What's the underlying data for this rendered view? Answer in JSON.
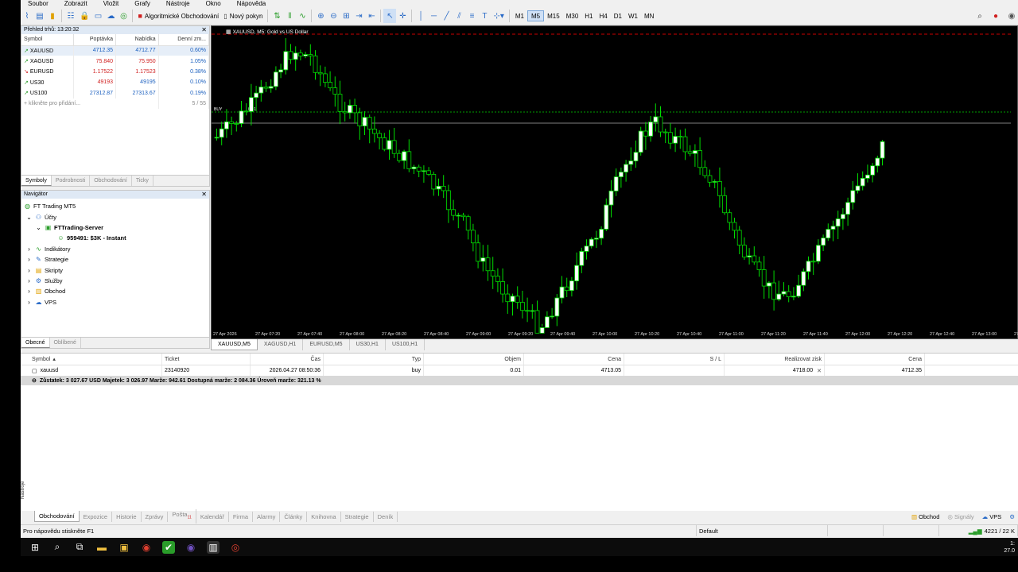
{
  "menu": [
    "Soubor",
    "Zobrazit",
    "Vložit",
    "Grafy",
    "Nástroje",
    "Okno",
    "Nápověda"
  ],
  "toolbar": {
    "algo_label": "Algoritmické Obchodování",
    "new_order_label": "Nový pokyn",
    "timeframes": [
      "M1",
      "M5",
      "M15",
      "M30",
      "H1",
      "H4",
      "D1",
      "W1",
      "MN"
    ],
    "active_timeframe": "M5"
  },
  "market_watch": {
    "title": "Přehled trhů: 13:20:32",
    "columns": [
      "Symbol",
      "Poptávka",
      "Nabídka",
      "Denní zm..."
    ],
    "rows": [
      {
        "symbol": "XAUUSD",
        "bid": "4712.35",
        "ask": "4712.77",
        "change": "0.60%",
        "dir": "up"
      },
      {
        "symbol": "XAGUSD",
        "bid": "75.840",
        "ask": "75.950",
        "change": "1.05%",
        "dir": "down"
      },
      {
        "symbol": "EURUSD",
        "bid": "1.17522",
        "ask": "1.17523",
        "change": "0.38%",
        "dir": "down"
      },
      {
        "symbol": "US30",
        "bid": "49193",
        "ask": "49195",
        "change": "0.10%",
        "dir": "down"
      },
      {
        "symbol": "US100",
        "bid": "27312.87",
        "ask": "27313.67",
        "change": "0.19%",
        "dir": "up"
      }
    ],
    "add_row": "klikněte pro přidání...",
    "count": "5 / 55",
    "tabs": [
      "Symboly",
      "Podrobnosti",
      "Obchodování",
      "Ticky"
    ]
  },
  "navigator": {
    "title": "Navigátor",
    "root": "FT Trading MT5",
    "accounts": "Účty",
    "server": "FTTrading-Server",
    "account": "959491: $3K - Instant",
    "items": [
      "Indikátory",
      "Strategie",
      "Skripty",
      "Služby",
      "Obchod",
      "VPS"
    ],
    "tabs": [
      "Obecné",
      "Oblíbené"
    ]
  },
  "chart": {
    "title": "XAUUSD, M5: Gold vs US Dollar",
    "buy_label": "BUY",
    "buy_value": "0.01",
    "time_labels": [
      "27 Apr 2026",
      "27 Apr 07:20",
      "27 Apr 07:40",
      "27 Apr 08:00",
      "27 Apr 08:20",
      "27 Apr 08:40",
      "27 Apr 09:00",
      "27 Apr 09:20",
      "27 Apr 09:40",
      "27 Apr 10:00",
      "27 Apr 10:20",
      "27 Apr 10:40",
      "27 Apr 11:00",
      "27 Apr 11:20",
      "27 Apr 11:40",
      "27 Apr 12:00",
      "27 Apr 12:20",
      "27 Apr 12:40",
      "27 Apr 13:00",
      "27 Apr 13:20"
    ],
    "tabs": [
      "XAUUSD,M5",
      "XAGUSD,H1",
      "EURUSD,M5",
      "US30,H1",
      "US100,H1"
    ],
    "colors": {
      "bull": "#ffffff",
      "bear": "#000000",
      "wick": "#00dd00",
      "trade": "#00a000",
      "sl": "#cc0000",
      "price": "#808080"
    }
  },
  "terminal": {
    "columns": [
      "Symbol",
      "Ticket",
      "Čas",
      "Typ",
      "Objem",
      "Cena",
      "S / L",
      "Realizovat zisk",
      "Cena"
    ],
    "position": {
      "symbol": "xauusd",
      "ticket": "23140920",
      "time": "2026.04.27 08:50:36",
      "type": "buy",
      "volume": "0.01",
      "price": "4713.05",
      "sl": "",
      "tp": "4718.00",
      "current": "4712.35"
    },
    "balance_line": "Zůstatek: 3 027.67 USD  Majetek: 3 026.97  Marže: 942.61  Dostupná marže: 2 084.36  Úroveň marže: 321.13 %",
    "side_label": "Nástroje",
    "tabs": [
      "Obchodování",
      "Expozice",
      "Historie",
      "Zprávy",
      "Pošta",
      "Kalendář",
      "Firma",
      "Alarmy",
      "Články",
      "Knihovna",
      "Strategie",
      "Deník"
    ],
    "mail_badge": "11",
    "right": [
      "Obchod",
      "Signály",
      "VPS"
    ]
  },
  "status": {
    "help": "Pro nápovědu stiskněte F1",
    "profile": "Default",
    "traffic": "4221 / 22 K"
  },
  "taskbar": {
    "time": "1:",
    "date": "27.0"
  }
}
